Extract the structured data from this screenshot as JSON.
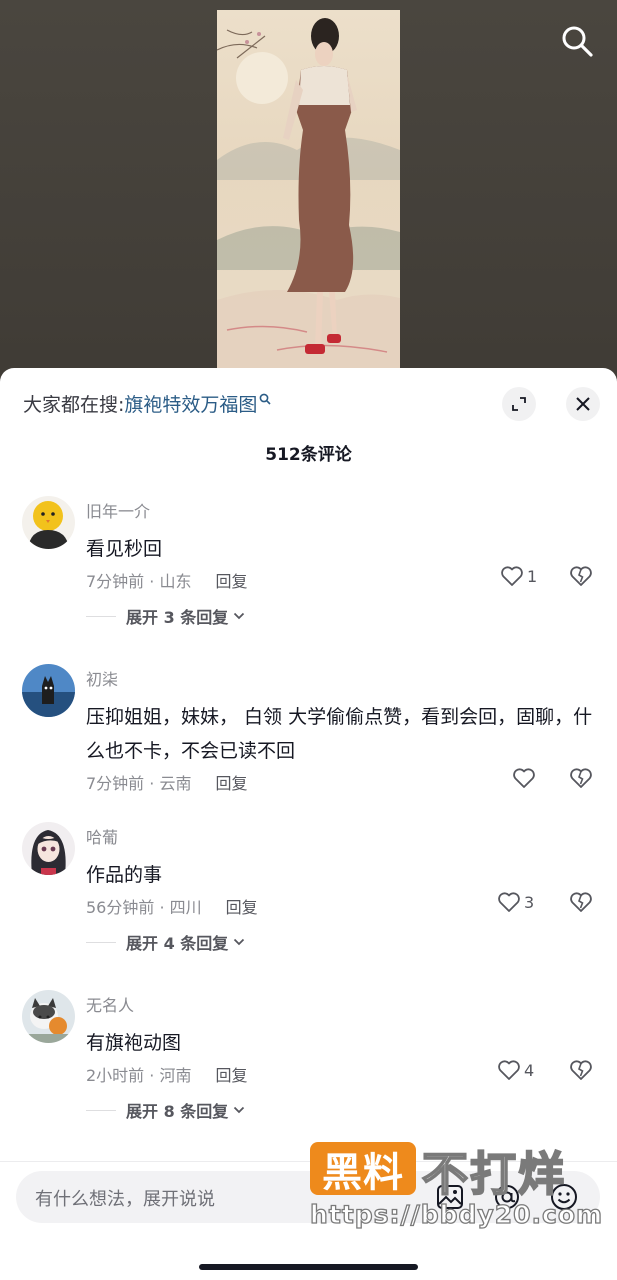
{
  "sheet": {
    "search_prefix": "大家都在搜:",
    "search_term": "旗袍特效万福图",
    "comment_count": "512条评论"
  },
  "comments": [
    {
      "user": "旧年一介",
      "text": "看见秒回",
      "meta": "7分钟前 · 山东",
      "reply": "回复",
      "likes": "1",
      "expand": "展开 3 条回复"
    },
    {
      "user": "初柒",
      "text": "压抑姐姐，妹妹， 白领 大学偷偷点赞，看到会回，固聊，什么也不卡，不会已读不回",
      "meta": "7分钟前 · 云南",
      "reply": "回复",
      "likes": ""
    },
    {
      "user": "哈葡",
      "text": "作品的事",
      "meta": "56分钟前 · 四川",
      "reply": "回复",
      "likes": "3",
      "expand": "展开 4 条回复"
    },
    {
      "user": "无名人",
      "text": "有旗袍动图",
      "meta": "2小时前 · 河南",
      "reply": "回复",
      "likes": "4",
      "expand": "展开 8 条回复"
    }
  ],
  "composer": {
    "placeholder": "有什么想法，展开说说"
  },
  "watermark": {
    "badge": "黑料",
    "text": "不打烊",
    "url": "https://bbdy20.com"
  },
  "colors": {
    "link": "#2b5c86",
    "text_primary": "#161823",
    "text_secondary": "#8a8b91",
    "watermark_orange": "#ee8a1c"
  },
  "icons": [
    "search-icon",
    "expand-icon",
    "close-icon",
    "heart-icon",
    "broken-heart-icon",
    "chevron-down-icon",
    "image-icon",
    "at-icon",
    "emoji-icon"
  ]
}
